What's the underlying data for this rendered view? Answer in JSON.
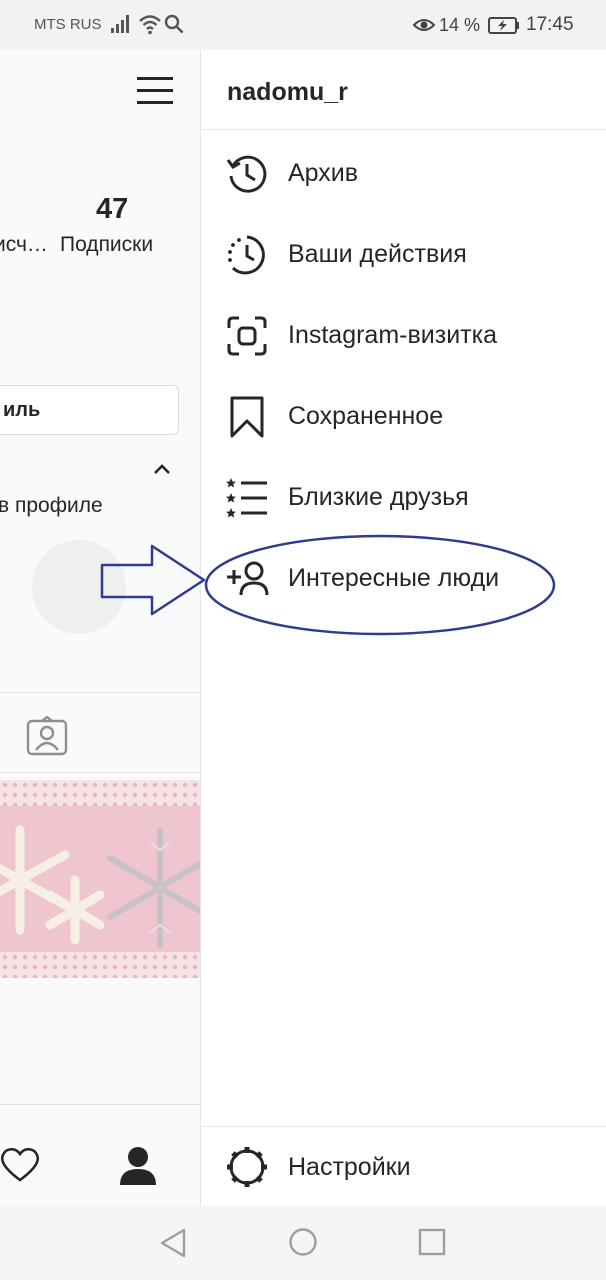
{
  "status_bar": {
    "carrier": "MTS RUS",
    "battery_percent": "14 %",
    "time": "17:45",
    "icons": [
      "signal-icon",
      "wifi-icon",
      "search-icon",
      "eye-icon",
      "battery-charging-icon"
    ]
  },
  "profile_background": {
    "following_count": "47",
    "followers_label_fragment": "исч…",
    "following_label": "Подписки",
    "edit_profile_fragment": "иль",
    "highlights_fragment": "в профиле"
  },
  "drawer": {
    "username": "nadomu_r",
    "items": [
      {
        "label": "Архив",
        "icon": "archive-history-icon"
      },
      {
        "label": "Ваши действия",
        "icon": "activity-clock-icon"
      },
      {
        "label": "Instagram-визитка",
        "icon": "nametag-scan-icon"
      },
      {
        "label": "Сохраненное",
        "icon": "bookmark-icon"
      },
      {
        "label": "Близкие друзья",
        "icon": "close-friends-list-icon"
      },
      {
        "label": "Интересные люди",
        "icon": "add-person-icon"
      }
    ],
    "settings_label": "Настройки"
  },
  "colors": {
    "annotation": "#2e3b8f",
    "text": "#262626",
    "divider": "#e6e6e6",
    "status_bar_bg": "#f2f2f2"
  }
}
